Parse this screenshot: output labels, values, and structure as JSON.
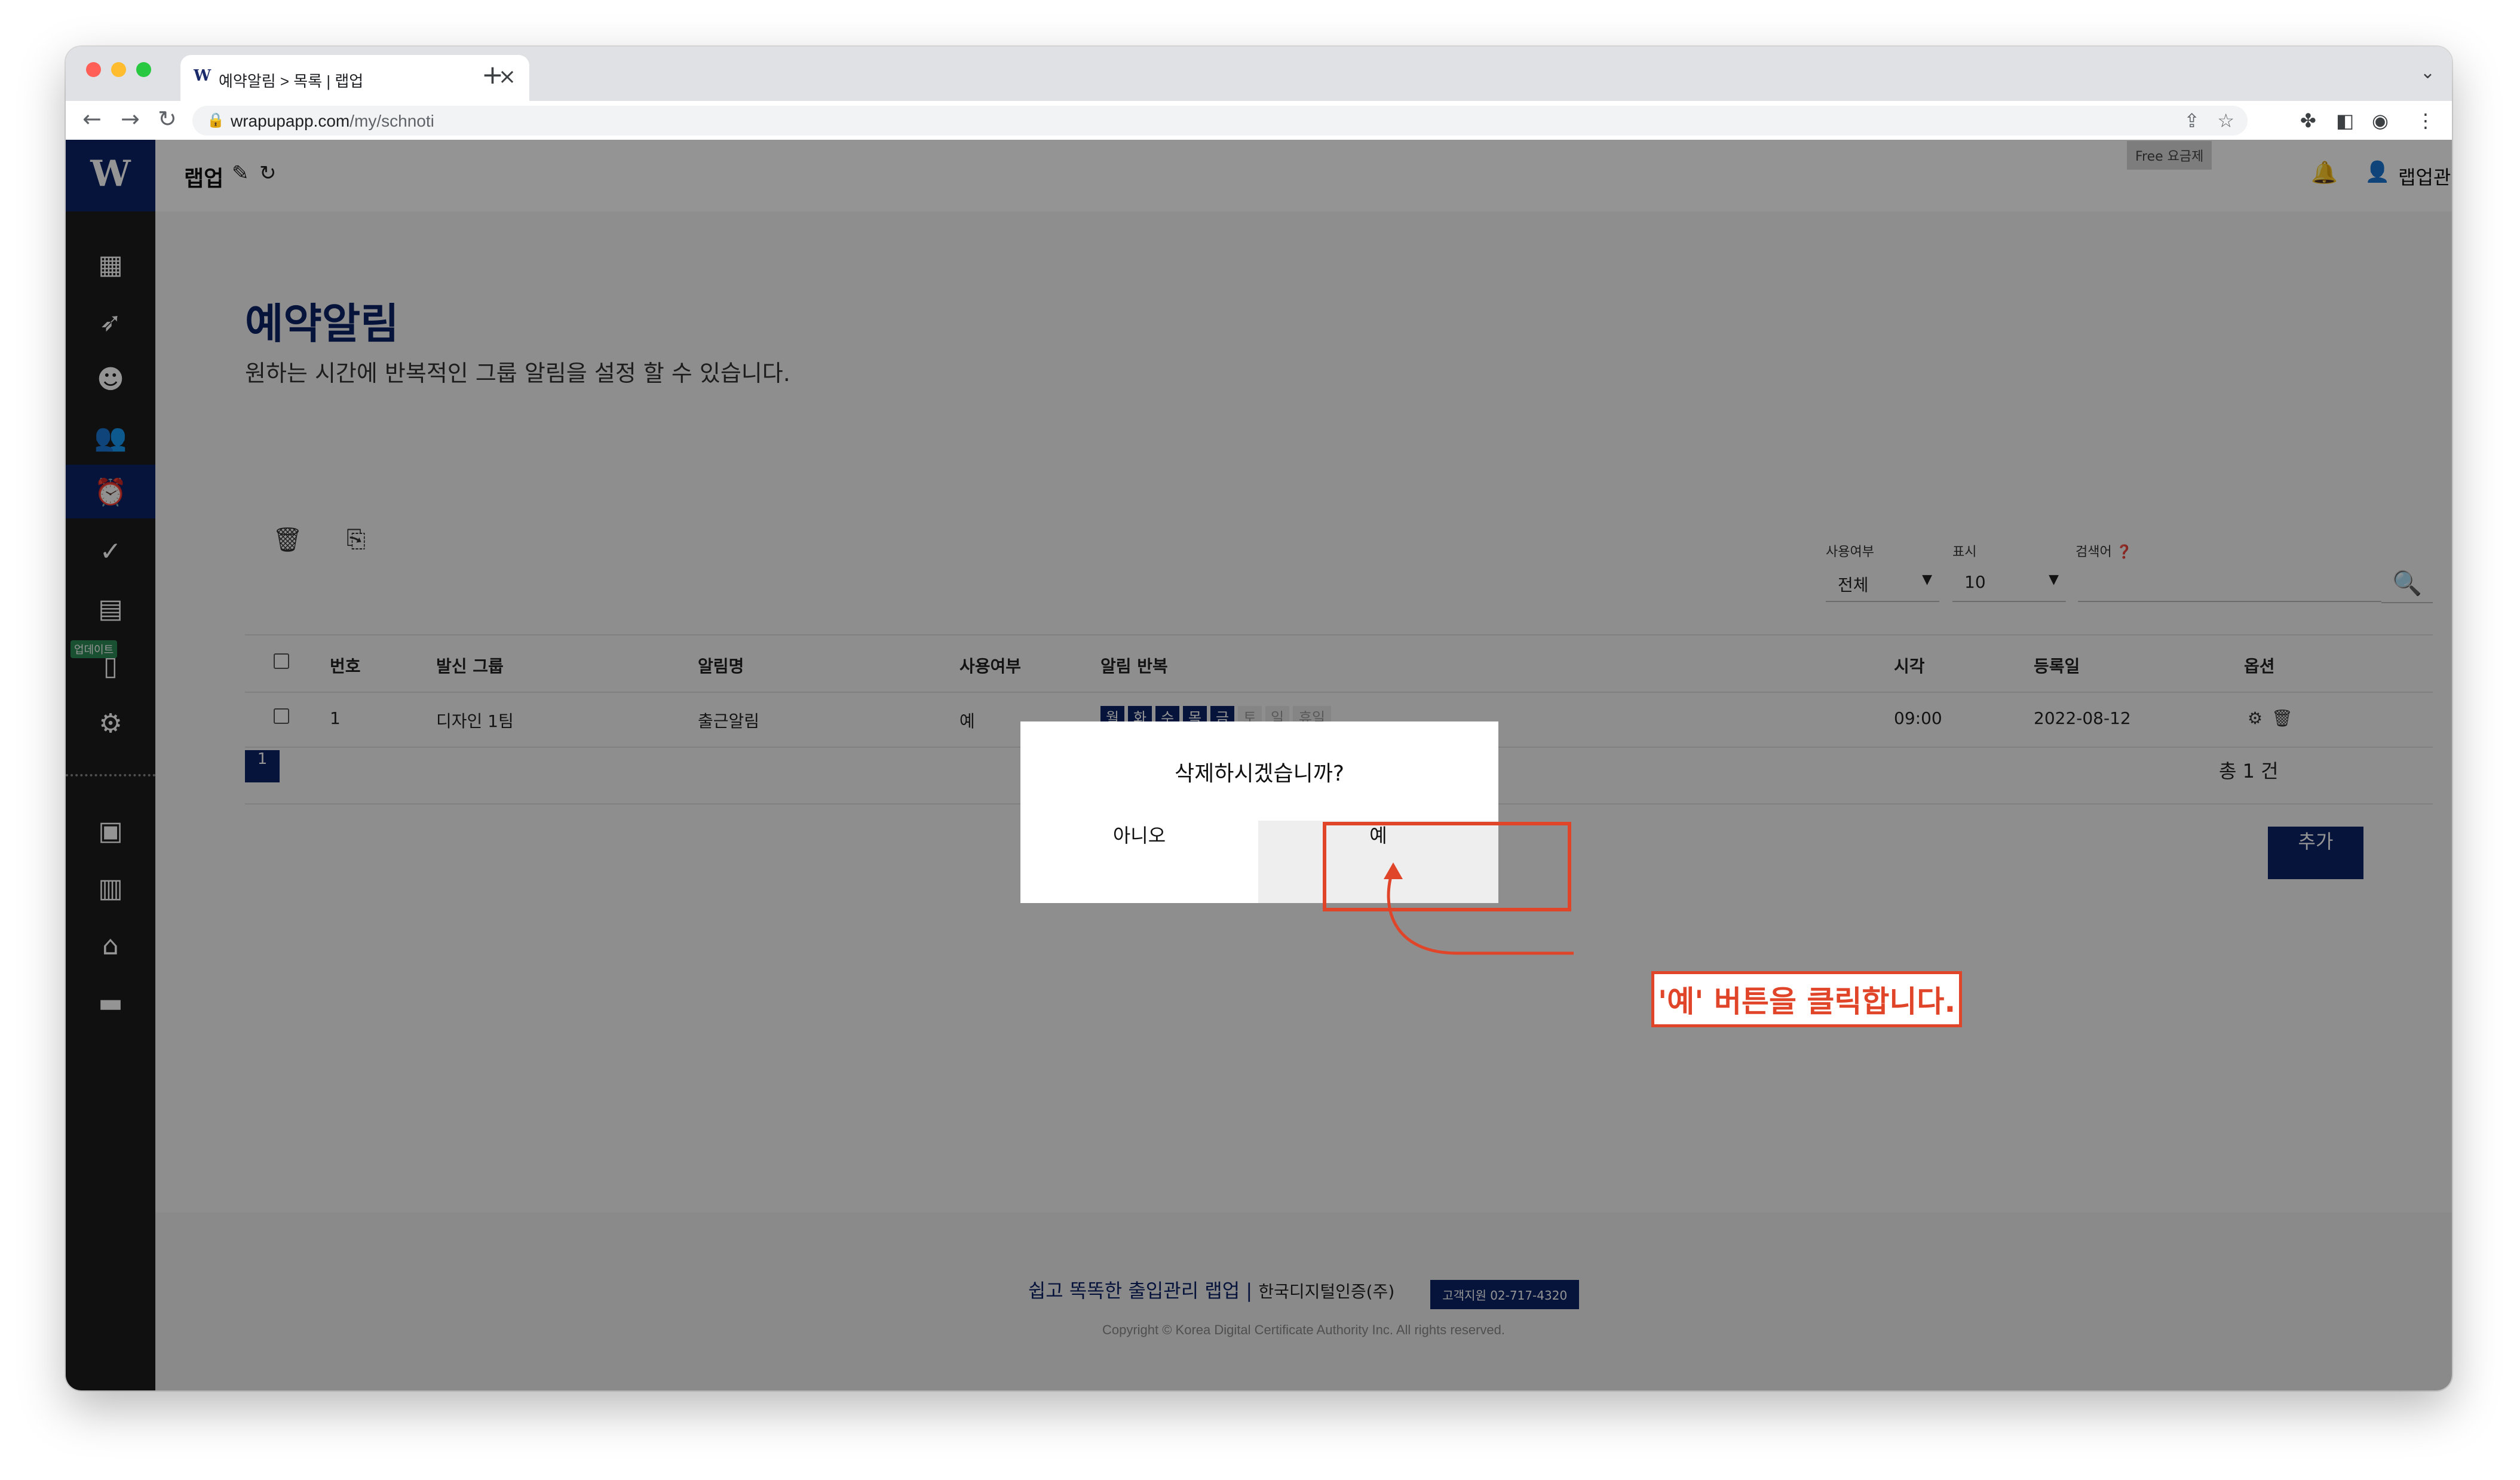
{
  "browser": {
    "tab_title": "예약알림 > 목록 | 랩업",
    "favicon": "W",
    "url_host": "wrapupapp.com",
    "url_path": "/my/schnoti",
    "traffic_light_colors": [
      "#ff5f57",
      "#febc2e",
      "#28c840"
    ]
  },
  "app": {
    "brand": "랩업",
    "logo": "W",
    "plan_badge": "Free 요금제",
    "user_name": "랩업관리자",
    "sidebar_badge": "업데이트"
  },
  "page": {
    "title": "예약알림",
    "subtitle": "원하는 시간에 반복적인 그룹 알림을 설정 할 수 있습니다."
  },
  "filters": {
    "usage_label": "사용여부",
    "usage_value": "전체",
    "display_label": "표시",
    "display_value": "10",
    "search_label": "검색어"
  },
  "table": {
    "headers": [
      "번호",
      "발신 그룹",
      "알림명",
      "사용여부",
      "알림 반복",
      "시각",
      "등록일",
      "옵션"
    ],
    "rows": [
      {
        "no": "1",
        "group": "디자인 1팀",
        "name": "출근알림",
        "used": "예",
        "days": [
          {
            "label": "월",
            "on": true
          },
          {
            "label": "화",
            "on": true
          },
          {
            "label": "수",
            "on": true
          },
          {
            "label": "목",
            "on": true
          },
          {
            "label": "금",
            "on": true
          },
          {
            "label": "토",
            "on": false
          },
          {
            "label": "일",
            "on": false
          },
          {
            "label": "휴일",
            "on": false
          }
        ],
        "time": "09:00",
        "date": "2022-08-12"
      }
    ]
  },
  "pagination": {
    "current": "1",
    "total": "총 1 건"
  },
  "buttons": {
    "add": "추가"
  },
  "footer": {
    "slogan": "쉽고 똑똑한 출입관리 랩업 | ",
    "company": "한국디지털인증(주)",
    "support": "고객지원 02-717-4320",
    "copyright": "Copyright © Korea Digital Certificate Authority Inc. All rights reserved."
  },
  "dialog": {
    "message": "삭제하시겠습니까?",
    "no": "아니오",
    "yes": "예"
  },
  "annotation": {
    "text": "'예' 버튼을 클릭합니다.",
    "color": "#e0452a"
  },
  "colors": {
    "primary": "#0b2166",
    "sidebar": "#1d1d1d"
  }
}
